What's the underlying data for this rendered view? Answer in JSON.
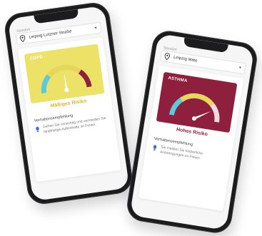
{
  "colors": {
    "moderate_bg": "#ece268",
    "high_bg": "#8e1f3d",
    "gauge_cyan": "#5ec9d9",
    "gauge_yellow": "#e6d65c",
    "gauge_red": "#8e1f3d"
  },
  "phones": [
    {
      "location_label": "Standort",
      "location_value": "Leipzig Lutzner Straße",
      "condition_title": "COPD",
      "risk_label": "Mäßiges Risiko",
      "risk_level": "moderate",
      "recommendation_title": "Verhaltensempfehlung",
      "recommendation_text": "Gehen Sie vorsichtig und vermeiden Sie langfristige Aufenthalte im Freien.",
      "icons": {
        "location": "location-pin-icon",
        "dropdown": "chevron-down-icon",
        "recommendation": "shoe-print-icon"
      }
    },
    {
      "location_label": "Standort",
      "location_value": "Leipzig Mitte",
      "condition_title": "ASTHMA",
      "risk_label": "Hohes Risiko",
      "risk_level": "high",
      "recommendation_title": "Verhaltensempfehlung",
      "recommendation_text": "Sie meiden Sie körperliche Anstrengungen im Freien.",
      "icons": {
        "location": "location-pin-icon",
        "dropdown": "chevron-down-icon",
        "recommendation": "shoe-print-icon"
      }
    }
  ]
}
